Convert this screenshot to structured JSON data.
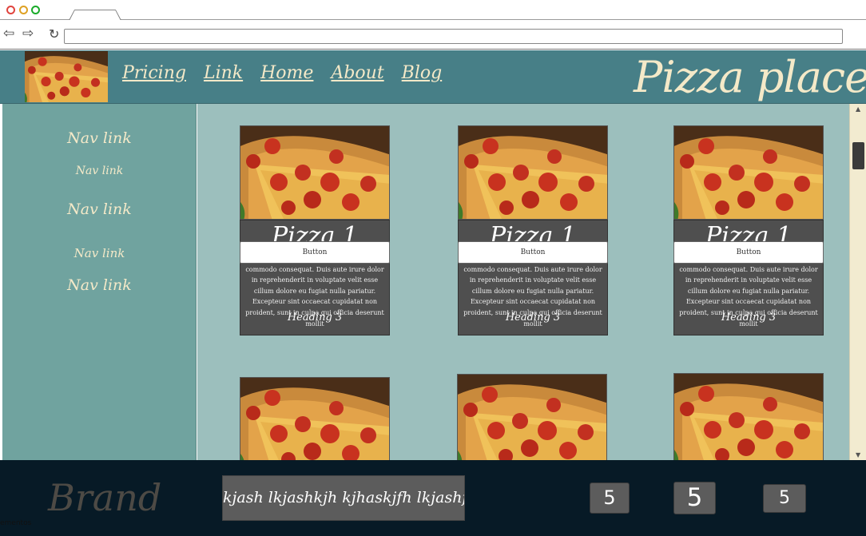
{
  "header": {
    "nav_links": [
      "Pricing",
      "Link",
      "Home",
      "About",
      "Blog"
    ],
    "title": "Pizza place"
  },
  "sidebar": {
    "links": [
      "Nav link",
      "Nav link",
      "Nav link",
      "Nav link",
      "Nav link"
    ]
  },
  "cards": [
    {
      "title": "Pizza 1",
      "text": "tation ullamco laboris nisi ut aliquip ex ea commodo consequat. Duis aute irure dolor in reprehenderit in voluptate velit esse cillum dolore eu fugiat nulla pariatur. Excepteur sint occaecat cupidatat non proident, sunt in culpa qui officia deserunt mollit",
      "heading": "Heading 3",
      "button": "Button"
    },
    {
      "title": "Pizza 1",
      "text": "tation ullamco laboris nisi ut aliquip ex ea commodo consequat. Duis aute irure dolor in reprehenderit in voluptate velit esse cillum dolore eu fugiat nulla pariatur. Excepteur sint occaecat cupidatat non proident, sunt in culpa qui officia deserunt mollit",
      "heading": "Heading 3",
      "button": "Button"
    },
    {
      "title": "Pizza 1",
      "text": "tation ullamco laboris nisi ut aliquip ex ea commodo consequat. Duis aute irure dolor in reprehenderit in voluptate velit esse cillum dolore eu fugiat nulla pariatur. Excepteur sint occaecat cupidatat non proident, sunt in culpa qui officia deserunt mollit",
      "heading": "Heading 3",
      "button": "Button"
    }
  ],
  "footer": {
    "brand": "Brand",
    "text": "kjash lkjashkjh kjhaskjfh lkjashfkjh",
    "buttons": [
      "5",
      "5",
      "5"
    ]
  },
  "corner_label": "ementos",
  "colors": {
    "header_bg": "#477f87",
    "sidebar_bg": "#70a39f",
    "content_bg": "#9cbfbd",
    "footer_bg": "#071a26",
    "accent_text": "#f4e9c8",
    "card_bg": "#4f4f4f"
  },
  "icons": [
    "back-arrow-icon",
    "forward-arrow-icon",
    "reload-icon",
    "pizza-image"
  ]
}
